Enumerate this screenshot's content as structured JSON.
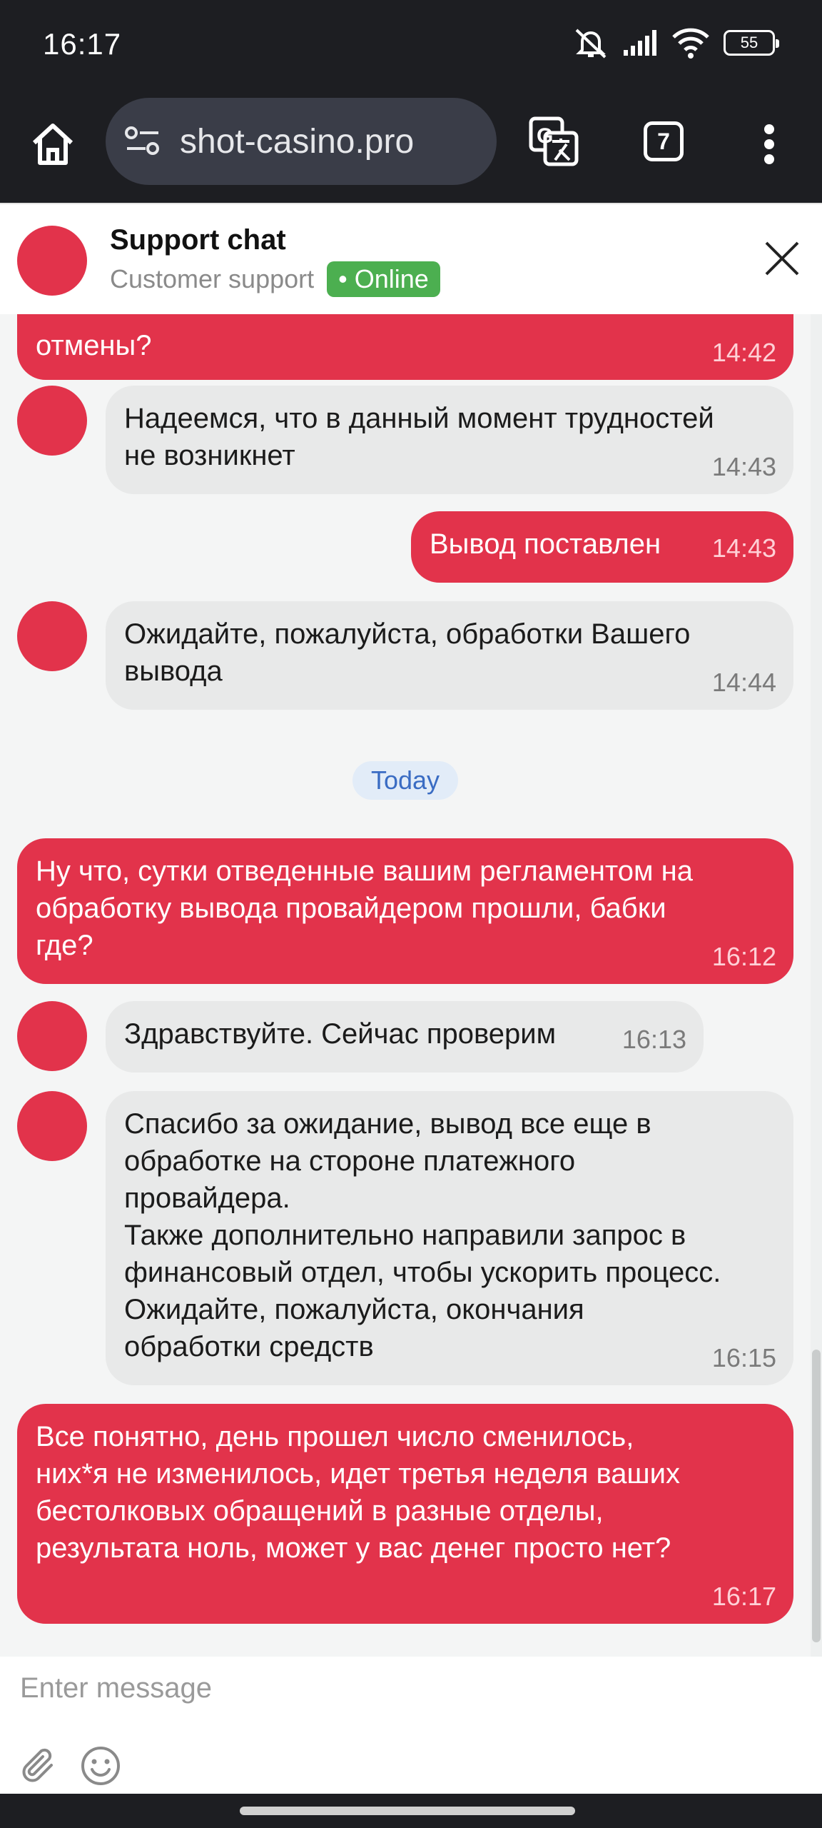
{
  "status_bar": {
    "time": "16:17",
    "battery": "55"
  },
  "browser": {
    "url": "shot-casino.pro",
    "tab_count": "7"
  },
  "header": {
    "title": "Support chat",
    "subtitle": "Customer support",
    "status": "• Online"
  },
  "date_separator": "Today",
  "messages": [
    {
      "side": "out",
      "text": "отмены?",
      "time": "14:42"
    },
    {
      "side": "in",
      "text": "Надеемся, что в данный момент трудностей\nне возникнет",
      "time": "14:43"
    },
    {
      "side": "out",
      "text": "Вывод поставлен",
      "time": "14:43"
    },
    {
      "side": "in",
      "text": "Ожидайте, пожалуйста, обработки Вашего\nвывода",
      "time": "14:44"
    },
    {
      "side": "out",
      "text": "Ну что, сутки отведенные вашим регламентом на\nобработку вывода провайдером прошли, бабки\nгде?",
      "time": "16:12"
    },
    {
      "side": "in",
      "text": "Здравствуйте. Сейчас проверим",
      "time": "16:13"
    },
    {
      "side": "in",
      "text": "Спасибо за ожидание, вывод все еще в\nобработке на стороне платежного\nпровайдера.\nТакже дополнительно направили запрос в\nфинансовый отдел, чтобы ускорить процесс.\nОжидайте, пожалуйста, окончания\nобработки средств",
      "time": "16:15"
    },
    {
      "side": "out",
      "text": "Все понятно, день прошел число сменилось,\nних*я не изменилось, идет третья неделя ваших\nбестолковых обращений в разные отделы,\nрезультата ноль, может у вас денег просто нет?",
      "time": "16:17"
    }
  ],
  "composer": {
    "placeholder": "Enter message"
  }
}
